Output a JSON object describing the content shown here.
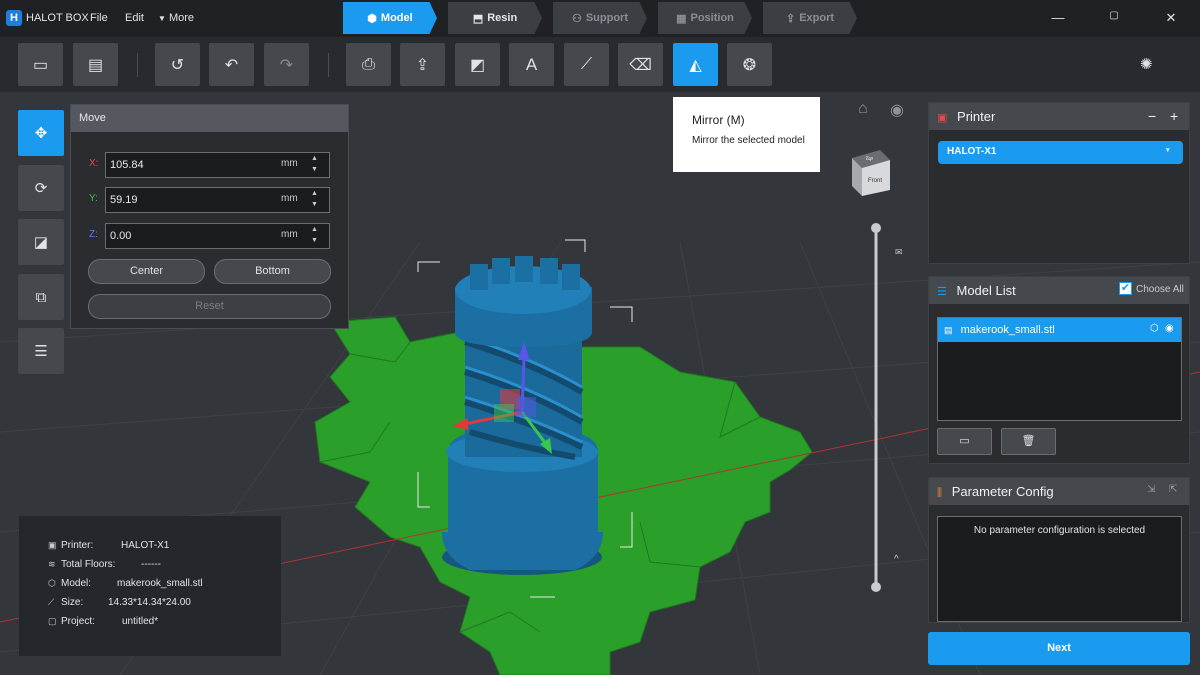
{
  "app": {
    "name": "HALOT BOX",
    "logo_letter": "H"
  },
  "menu": {
    "file": "File",
    "edit": "Edit",
    "more": "More"
  },
  "steps": [
    {
      "label": "Model",
      "state": "active"
    },
    {
      "label": "Resin",
      "state": "enabled"
    },
    {
      "label": "Support",
      "state": "disabled"
    },
    {
      "label": "Position",
      "state": "disabled"
    },
    {
      "label": "Export",
      "state": "disabled"
    }
  ],
  "window": {
    "minimize": "—",
    "maximize": "▢",
    "close": "✕"
  },
  "toolbar": {
    "icons": [
      "open-folder-icon",
      "import-icon",
      "history-icon",
      "undo-icon",
      "redo-icon",
      "print-icon",
      "export-icon",
      "split-icon",
      "text-icon",
      "measure-icon",
      "erase-icon",
      "mirror-icon",
      "hollow-icon",
      "settings-icon"
    ],
    "active": "mirror-icon"
  },
  "tooltip": {
    "title": "Mirror (M)",
    "description": "Mirror the selected model"
  },
  "move": {
    "title": "Move",
    "x_label": "X:",
    "x_value": "105.84",
    "y_label": "Y:",
    "y_value": "59.19",
    "z_label": "Z:",
    "z_value": "0.00",
    "unit": "mm",
    "center": "Center",
    "bottom": "Bottom",
    "reset": "Reset"
  },
  "view_cube": {
    "top": "Top",
    "front": "Front"
  },
  "info": {
    "printer_key": "Printer:",
    "printer_val": "HALOT-X1",
    "floors_key": "Total Floors:",
    "floors_val": "------",
    "model_key": "Model:",
    "model_val": "makerook_small.stl",
    "size_key": "Size:",
    "size_val": "14.33*14.34*24.00",
    "project_key": "Project:",
    "project_val": "untitled*"
  },
  "printer_panel": {
    "title": "Printer",
    "selected": "HALOT-X1",
    "minus": "−",
    "plus": "+"
  },
  "model_list": {
    "title": "Model List",
    "choose_all": "Choose All",
    "items": [
      "makerook_small.stl"
    ]
  },
  "param_panel": {
    "title": "Parameter Config",
    "empty": "No parameter configuration is selected"
  },
  "next": "Next",
  "colors": {
    "accent": "#1a9bf0",
    "plate": "#2aa02a",
    "model": "#1b6fa3"
  }
}
